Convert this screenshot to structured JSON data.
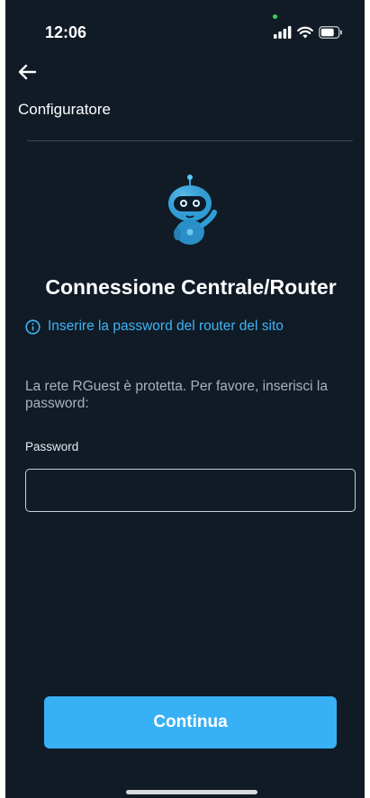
{
  "status_bar": {
    "time": "12:06",
    "icons": [
      "signal-icon",
      "wifi-icon",
      "battery-icon"
    ]
  },
  "header": {
    "back_icon": "arrow-left-icon",
    "title": "Configuratore"
  },
  "main": {
    "illustration": "robot-mascot",
    "title": "Connessione Centrale/Router",
    "info": {
      "icon": "info-icon",
      "text": "Inserire la password del router del sito"
    },
    "description": "La rete RGuest  è protetta. Per favore, inserisci la password:",
    "password": {
      "label": "Password",
      "value": "",
      "placeholder": ""
    },
    "continue_label": "Continua"
  },
  "colors": {
    "background": "#101b26",
    "accent": "#37b0f5",
    "info_text": "#3fb4f5",
    "status_dot": "#3ccf5c"
  }
}
